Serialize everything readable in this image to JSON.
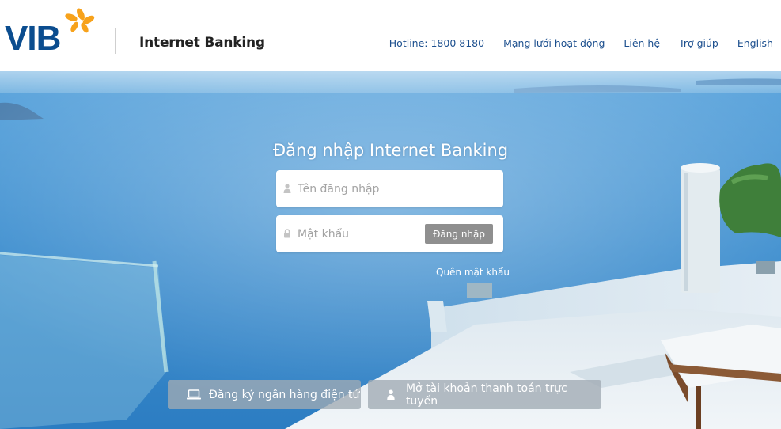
{
  "brand": {
    "logo_text": "VIB",
    "product_title": "Internet Banking",
    "colors": {
      "logo_blue": "#0b4d8f",
      "logo_orange": "#f7a21b",
      "nav_link": "#1c4f8e"
    }
  },
  "nav": {
    "hotline": "Hotline: 1800 8180",
    "network": "Mạng lưới hoạt động",
    "contact": "Liên hệ",
    "help": "Trợ giúp",
    "language": "English"
  },
  "login": {
    "title": "Đăng nhập Internet Banking",
    "username_placeholder": "Tên đăng nhập",
    "username_value": "",
    "username_icon": "user-icon",
    "password_placeholder": "Mật khẩu",
    "password_value": "",
    "password_icon": "lock-icon",
    "submit_label": "Đăng nhập",
    "forgot_label": "Quên mật khẩu"
  },
  "actions": {
    "register_label": "Đăng ký ngân hàng điện tử",
    "register_icon": "laptop-icon",
    "open_account_label": "Mở tài khoản thanh toán trực tuyến",
    "open_account_icon": "user-icon"
  }
}
